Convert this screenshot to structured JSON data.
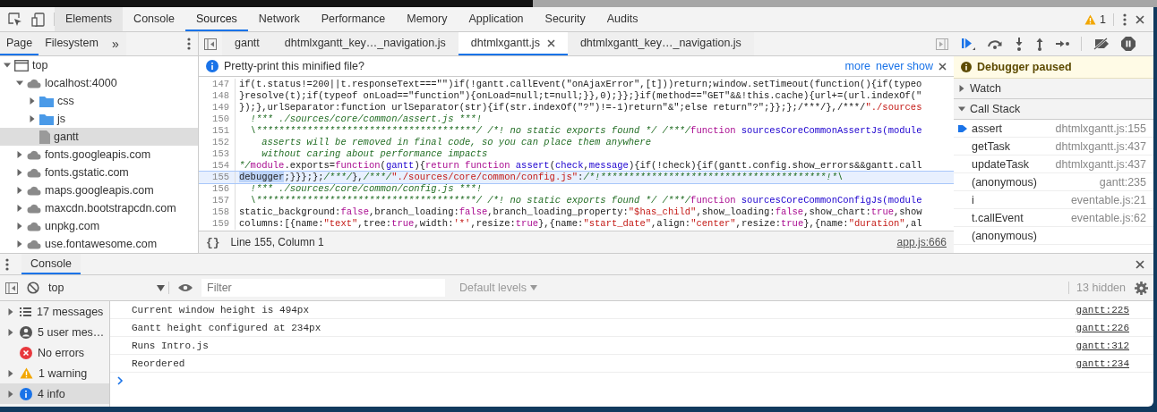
{
  "main_tabs": [
    {
      "label": "Elements",
      "selected": false,
      "hovered": true
    },
    {
      "label": "Console",
      "selected": false,
      "hovered": false
    },
    {
      "label": "Sources",
      "selected": true,
      "hovered": false
    },
    {
      "label": "Network",
      "selected": false,
      "hovered": false
    },
    {
      "label": "Performance",
      "selected": false,
      "hovered": false
    },
    {
      "label": "Memory",
      "selected": false,
      "hovered": false
    },
    {
      "label": "Application",
      "selected": false,
      "hovered": false
    },
    {
      "label": "Security",
      "selected": false,
      "hovered": false
    },
    {
      "label": "Audits",
      "selected": false,
      "hovered": false
    }
  ],
  "warning_count": "1",
  "navigator": {
    "tabs": [
      {
        "label": "Page",
        "selected": true
      },
      {
        "label": "Filesystem",
        "selected": false
      }
    ],
    "more": "»",
    "tree": [
      {
        "label": "top",
        "kind": "frame",
        "expanded": true,
        "selected": false,
        "children": [
          {
            "label": "localhost:4000",
            "kind": "domain",
            "expanded": true,
            "selected": false,
            "children": [
              {
                "label": "css",
                "kind": "folder",
                "expanded": false,
                "selected": false
              },
              {
                "label": "js",
                "kind": "folder",
                "expanded": false,
                "selected": false
              },
              {
                "label": "gantt",
                "kind": "file",
                "selected": true
              }
            ]
          },
          {
            "label": "fonts.googleapis.com",
            "kind": "domain",
            "expanded": false,
            "selected": false
          },
          {
            "label": "fonts.gstatic.com",
            "kind": "domain",
            "expanded": false,
            "selected": false
          },
          {
            "label": "maps.googleapis.com",
            "kind": "domain",
            "expanded": false,
            "selected": false
          },
          {
            "label": "maxcdn.bootstrapcdn.com",
            "kind": "domain",
            "expanded": false,
            "selected": false
          },
          {
            "label": "unpkg.com",
            "kind": "domain",
            "expanded": false,
            "selected": false
          },
          {
            "label": "use.fontawesome.com",
            "kind": "domain",
            "expanded": false,
            "selected": false
          }
        ]
      }
    ]
  },
  "editor": {
    "tabs": [
      {
        "label": "gantt",
        "selected": false,
        "closable": false
      },
      {
        "label": "dhtmlxgantt_key…_navigation.js",
        "selected": false,
        "closable": false
      },
      {
        "label": "dhtmlxgantt.js",
        "selected": true,
        "closable": true
      },
      {
        "label": "dhtmlxgantt_key…_navigation.js",
        "selected": false,
        "closable": false
      }
    ],
    "infobar": {
      "message": "Pretty-print this minified file?",
      "links": [
        "more",
        "never show"
      ]
    },
    "lines": [
      {
        "number": "147",
        "current": false,
        "segments": [
          {
            "kind": "plain",
            "text": "if(t.status!=200||t.responseText===\"\")if(!gantt.callEvent(\"onAjaxError\",[t]))return;window.setTimeout(function(){if(typeo"
          }
        ]
      },
      {
        "number": "148",
        "current": false,
        "segments": [
          {
            "kind": "plain",
            "text": "}resolve(t);if(typeof onLoad==\"function\"){onLoad=null;t=null;}},0);}};}if(method==\"GET\"&&!this.cache){url+=(url.indexOf(\""
          }
        ]
      },
      {
        "number": "149",
        "current": false,
        "segments": [
          {
            "kind": "plain",
            "text": "});},urlSeparator:function urlSeparator(str){if(str.indexOf(\"?\")!=-1)return\"&\";else return\"?\";}};};/***/},/***/"
          },
          {
            "kind": "string",
            "text": "\"./sources"
          }
        ]
      },
      {
        "number": "150",
        "current": false,
        "segments": [
          {
            "kind": "comment",
            "text": "  !*** ./sources/core/common/assert.js ***!"
          }
        ]
      },
      {
        "number": "151",
        "current": false,
        "segments": [
          {
            "kind": "comment",
            "text": "  \\***************************************/ /*! no static exports found */ /***/"
          },
          {
            "kind": "keyword",
            "text": "function"
          },
          {
            "kind": "name",
            "text": " sourcesCoreCommonAssertJs(module"
          }
        ]
      },
      {
        "number": "152",
        "current": false,
        "segments": [
          {
            "kind": "comment",
            "text": "    asserts will be removed in final code, so you can place them anywhere"
          }
        ]
      },
      {
        "number": "153",
        "current": false,
        "segments": [
          {
            "kind": "comment",
            "text": "    without caring about performance impacts"
          }
        ]
      },
      {
        "number": "154",
        "current": false,
        "segments": [
          {
            "kind": "comment",
            "text": "*/"
          },
          {
            "kind": "keyword",
            "text": "module"
          },
          {
            "kind": "plain",
            "text": ".exports="
          },
          {
            "kind": "keyword",
            "text": "function"
          },
          {
            "kind": "plain",
            "text": "("
          },
          {
            "kind": "name",
            "text": "gantt"
          },
          {
            "kind": "plain",
            "text": "){"
          },
          {
            "kind": "keyword",
            "text": "return function"
          },
          {
            "kind": "name",
            "text": " assert"
          },
          {
            "kind": "plain",
            "text": "("
          },
          {
            "kind": "name",
            "text": "check"
          },
          {
            "kind": "plain",
            "text": ","
          },
          {
            "kind": "name",
            "text": "message"
          },
          {
            "kind": "plain",
            "text": "){if(!check){if(gantt.config.show_errors&&gantt.call"
          }
        ]
      },
      {
        "number": "155",
        "current": true,
        "segments": [
          {
            "kind": "selected",
            "text": "debugger"
          },
          {
            "kind": "plain",
            "text": ";}}};};"
          },
          {
            "kind": "comment",
            "text": "/***/"
          },
          {
            "kind": "plain",
            "text": "},"
          },
          {
            "kind": "comment",
            "text": "/***/"
          },
          {
            "kind": "string",
            "text": "\"./sources/core/common/config.js\""
          },
          {
            "kind": "plain",
            "text": ":"
          },
          {
            "kind": "comment",
            "text": "/*!****************************************!*\\"
          }
        ]
      },
      {
        "number": "156",
        "current": false,
        "segments": [
          {
            "kind": "comment",
            "text": "  !*** ./sources/core/common/config.js ***!"
          }
        ]
      },
      {
        "number": "157",
        "current": false,
        "segments": [
          {
            "kind": "comment",
            "text": "  \\***************************************/ /*! no static exports found */ /***/"
          },
          {
            "kind": "keyword",
            "text": "function"
          },
          {
            "kind": "name",
            "text": " sourcesCoreCommonConfigJs(module"
          }
        ]
      },
      {
        "number": "158",
        "current": false,
        "segments": [
          {
            "kind": "plain",
            "text": "static_background:"
          },
          {
            "kind": "literal",
            "text": "false"
          },
          {
            "kind": "plain",
            "text": ",branch_loading:"
          },
          {
            "kind": "literal",
            "text": "false"
          },
          {
            "kind": "plain",
            "text": ",branch_loading_property:"
          },
          {
            "kind": "string",
            "text": "\"$has_child\""
          },
          {
            "kind": "plain",
            "text": ",show_loading:"
          },
          {
            "kind": "literal",
            "text": "false"
          },
          {
            "kind": "plain",
            "text": ",show_chart:"
          },
          {
            "kind": "literal",
            "text": "true"
          },
          {
            "kind": "plain",
            "text": ",show"
          }
        ]
      },
      {
        "number": "159",
        "current": false,
        "segments": [
          {
            "kind": "plain",
            "text": "columns:[{name:"
          },
          {
            "kind": "string",
            "text": "\"text\""
          },
          {
            "kind": "plain",
            "text": ",tree:"
          },
          {
            "kind": "literal",
            "text": "true"
          },
          {
            "kind": "plain",
            "text": ",width:"
          },
          {
            "kind": "string",
            "text": "'*'"
          },
          {
            "kind": "plain",
            "text": ",resize:"
          },
          {
            "kind": "literal",
            "text": "true"
          },
          {
            "kind": "plain",
            "text": "},{name:"
          },
          {
            "kind": "string",
            "text": "\"start_date\""
          },
          {
            "kind": "plain",
            "text": ",align:"
          },
          {
            "kind": "string",
            "text": "\"center\""
          },
          {
            "kind": "plain",
            "text": ",resize:"
          },
          {
            "kind": "literal",
            "text": "true"
          },
          {
            "kind": "plain",
            "text": "},{name:"
          },
          {
            "kind": "string",
            "text": "\"duration\""
          },
          {
            "kind": "plain",
            "text": ",al"
          }
        ]
      }
    ],
    "pretty_print_button": "{}",
    "status": {
      "position": "Line 155, Column 1",
      "source": "app.js:666"
    }
  },
  "debugger_sidebar": {
    "paused_message": "Debugger paused",
    "sections": [
      {
        "title": "Watch",
        "expanded": false
      },
      {
        "title": "Call Stack",
        "expanded": true
      }
    ],
    "call_stack": [
      {
        "function": "assert",
        "location": "dhtmlxgantt.js:155",
        "current": true
      },
      {
        "function": "getTask",
        "location": "dhtmlxgantt.js:437",
        "current": false
      },
      {
        "function": "updateTask",
        "location": "dhtmlxgantt.js:437",
        "current": false
      },
      {
        "function": "(anonymous)",
        "location": "gantt:235",
        "current": false
      },
      {
        "function": "i",
        "location": "eventable.js:21",
        "current": false
      },
      {
        "function": "t.callEvent",
        "location": "eventable.js:62",
        "current": false
      },
      {
        "function": "(anonymous)",
        "current": false
      }
    ]
  },
  "console": {
    "drawer_tab": "Console",
    "context": "top",
    "filter_placeholder": "Filter",
    "levels": "Default levels",
    "hidden_count": "13 hidden",
    "sidebar": [
      {
        "label": "17 messages",
        "kind": "all",
        "expandable": true,
        "selected": false
      },
      {
        "label": "5 user mes…",
        "kind": "user",
        "expandable": true,
        "selected": false
      },
      {
        "label": "No errors",
        "kind": "error",
        "expandable": false,
        "selected": false
      },
      {
        "label": "1 warning",
        "kind": "warning",
        "expandable": true,
        "selected": false
      },
      {
        "label": "4 info",
        "kind": "info",
        "expandable": true,
        "selected": true
      }
    ],
    "messages": [
      {
        "text": "Current window height is 494px",
        "source": "gantt:225"
      },
      {
        "text": "Gantt height configured at 234px",
        "source": "gantt:226"
      },
      {
        "text": "Runs Intro.js",
        "source": "gantt:312"
      },
      {
        "text": "Reordered",
        "source": "gantt:234"
      }
    ]
  }
}
